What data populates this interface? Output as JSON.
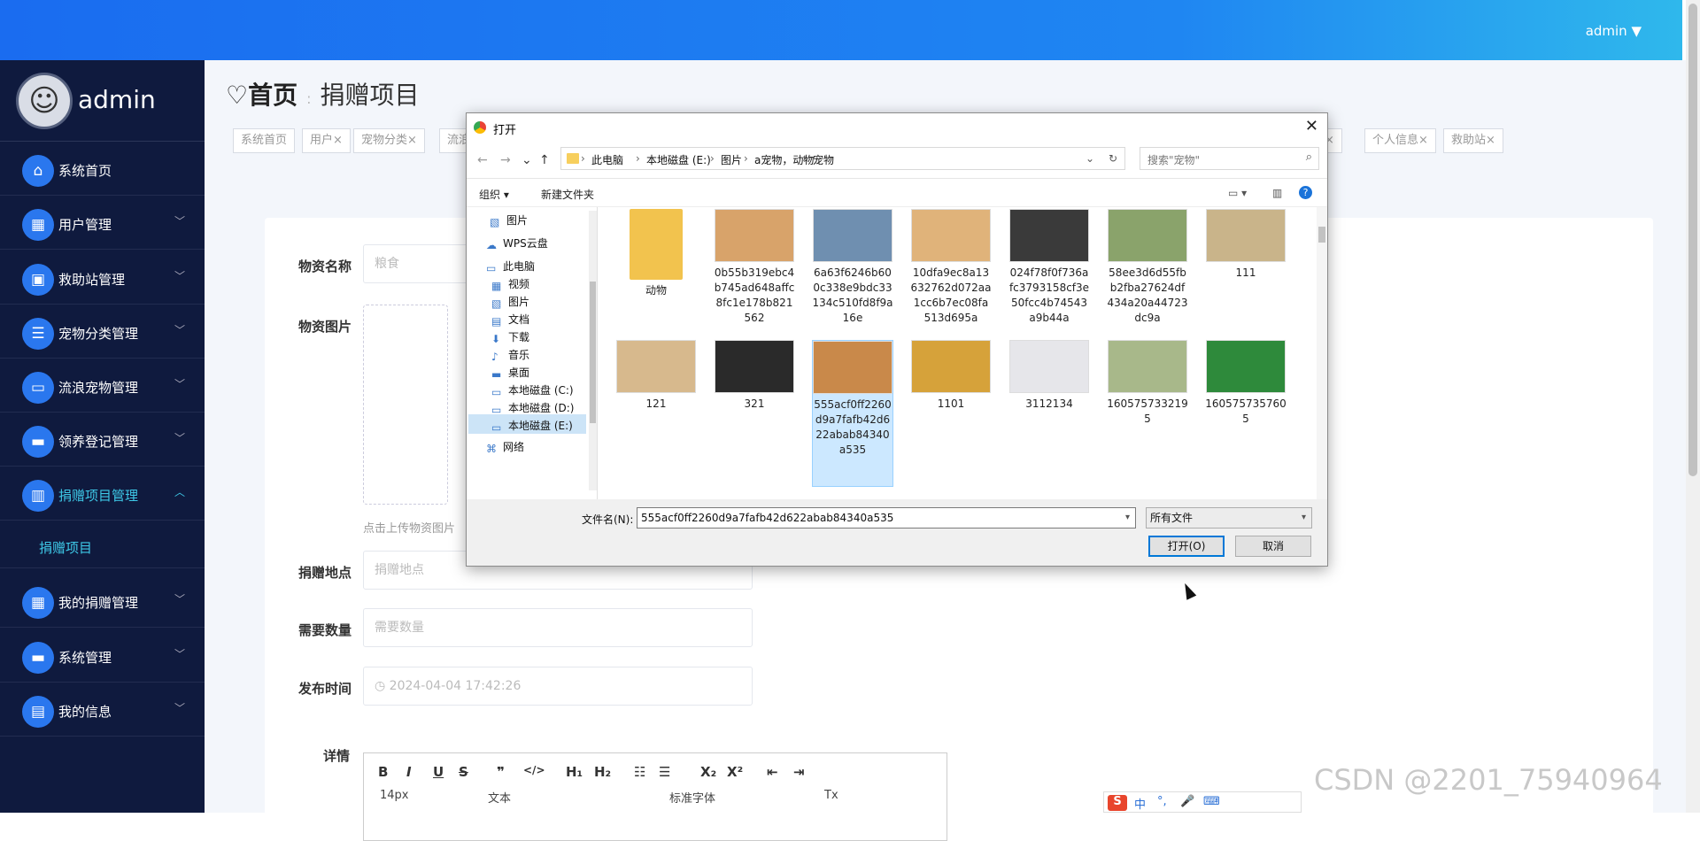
{
  "topbar": {
    "user": "admin ▼"
  },
  "sidebar": {
    "username": "admin",
    "items": [
      {
        "label": "系统首页",
        "icon": "home-icon",
        "glyph": "⌂"
      },
      {
        "label": "用户管理",
        "icon": "grid-icon",
        "glyph": "▦"
      },
      {
        "label": "救助站管理",
        "icon": "building-icon",
        "glyph": "▣"
      },
      {
        "label": "宠物分类管理",
        "icon": "sliders-icon",
        "glyph": "☰"
      },
      {
        "label": "流浪宠物管理",
        "icon": "chat-icon",
        "glyph": "▭"
      },
      {
        "label": "领养登记管理",
        "icon": "monitor-icon",
        "glyph": "▬"
      },
      {
        "label": "捐赠项目管理",
        "icon": "chart-icon",
        "glyph": "▥"
      },
      {
        "label": "我的捐赠管理",
        "icon": "grid-icon",
        "glyph": "▦"
      },
      {
        "label": "系统管理",
        "icon": "monitor-icon",
        "glyph": "▬"
      },
      {
        "label": "我的信息",
        "icon": "card-icon",
        "glyph": "▤"
      }
    ],
    "submenu": "捐赠项目"
  },
  "breadcrumb": {
    "home": "♡首页",
    "sep": ":",
    "current": "捐赠项目"
  },
  "tags": [
    "系统首页",
    "用户×",
    "宠物分类×",
    "流浪",
    "网×",
    "个人信息×",
    "救助站×"
  ],
  "form": {
    "name_label": "物资名称",
    "name_placeholder": "粮食",
    "image_label": "物资图片",
    "image_hint": "点击上传物资图片",
    "place_label": "捐赠地点",
    "place_placeholder": "捐赠地点",
    "qty_label": "需要数量",
    "qty_placeholder": "需要数量",
    "time_label": "发布时间",
    "time_value": "◷  2024-04-04 17:42:26",
    "detail_label": "详情",
    "toolbar": {
      "bold": "B",
      "italic": "I",
      "underline": "U",
      "strike": "S",
      "quote": "❞",
      "code": "</>",
      "h1": "H₁",
      "h2": "H₂",
      "ol": "☷",
      "ul": "☰",
      "sub": "X₂",
      "sup": "X²",
      "outdent": "⇤",
      "indent": "⇥",
      "size": "14px",
      "text": "文本",
      "font": "标准字体",
      "clear": "Tx"
    }
  },
  "dialog": {
    "title": "打开",
    "path": [
      "此电脑",
      "本地磁盘 (E:)",
      "图片",
      "a宠物，动物",
      "宠物"
    ],
    "search_placeholder": "搜索\"宠物\"",
    "organize": "组织 ▾",
    "new_folder": "新建文件夹",
    "tree": [
      {
        "label": "图片",
        "icon": "pictures-icon"
      },
      {
        "label": "WPS云盘",
        "icon": "cloud-icon"
      },
      {
        "label": "此电脑",
        "icon": "computer-icon"
      },
      {
        "label": "视频",
        "icon": "video-icon"
      },
      {
        "label": "图片",
        "icon": "pictures-icon"
      },
      {
        "label": "文档",
        "icon": "document-icon"
      },
      {
        "label": "下载",
        "icon": "download-icon"
      },
      {
        "label": "音乐",
        "icon": "music-icon"
      },
      {
        "label": "桌面",
        "icon": "desktop-icon"
      },
      {
        "label": "本地磁盘 (C:)",
        "icon": "drive-icon"
      },
      {
        "label": "本地磁盘 (D:)",
        "icon": "drive-icon"
      },
      {
        "label": "本地磁盘 (E:)",
        "icon": "drive-icon"
      },
      {
        "label": "网络",
        "icon": "network-icon"
      }
    ],
    "files": [
      {
        "name": "动物",
        "color": "#f2c34e"
      },
      {
        "name": "0b55b319ebc4b745ad648affc8fc1e178b821562",
        "color": "#d8a36a"
      },
      {
        "name": "6a63f6246b600c338e9bdc33134c510fd8f9a16e",
        "color": "#6f8fb0"
      },
      {
        "name": "10dfa9ec8a13632762d072aa1cc6b7ec08fa513d695a",
        "color": "#e0b37a"
      },
      {
        "name": "024f78f0f736afc3793158cf3e50fcc4b74543a9b44a",
        "color": "#3a3a3a"
      },
      {
        "name": "58ee3d6d55fbb2fba27624df434a20a44723dc9a",
        "color": "#8aa36b"
      },
      {
        "name": "111",
        "color": "#c9b48a"
      },
      {
        "name": "121",
        "color": "#d7b98d"
      },
      {
        "name": "321",
        "color": "#2a2a2a"
      },
      {
        "name": "555acf0ff2260d9a7fafb42d622abab84340a535",
        "color": "#c9894a"
      },
      {
        "name": "1101",
        "color": "#d6a23a"
      },
      {
        "name": "3112134",
        "color": "#e6e6ea"
      },
      {
        "name": "1605757332195",
        "color": "#a8b88a"
      },
      {
        "name": "1605757357605",
        "color": "#2e8a3b"
      }
    ],
    "filename_label": "文件名(N):",
    "filename_value": "555acf0ff2260d9a7fafb42d622abab84340a535",
    "filetype": "所有文件",
    "open": "打开(O)",
    "cancel": "取消"
  },
  "watermark": "CSDN @2201_75940964",
  "ime": [
    "中",
    "°,",
    "🎤",
    "⌨"
  ]
}
